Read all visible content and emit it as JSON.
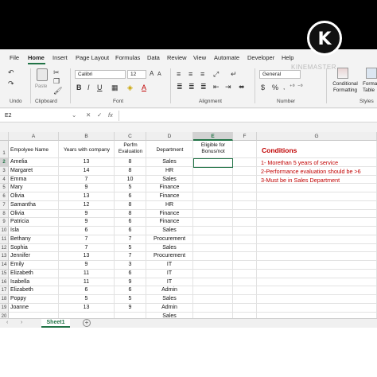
{
  "menu": {
    "file": "File",
    "home": "Home",
    "insert": "Insert",
    "page_layout": "Page Layout",
    "formulas": "Formulas",
    "data": "Data",
    "review": "Review",
    "view": "View",
    "automate": "Automate",
    "developer": "Developer",
    "help": "Help"
  },
  "ribbon": {
    "undo_label": "Undo",
    "clipboard_label": "Clipboard",
    "paste_label": "Paste",
    "font_name": "Calibri",
    "font_size": "12",
    "font_label": "Font",
    "alignment_label": "Alignment",
    "number_format": "General",
    "number_label": "Number",
    "conditional_formatting": "Conditional Formatting",
    "format_as_table": "Format as Table",
    "styles_label": "Styles",
    "currency_symbol": "$",
    "percent_symbol": "%"
  },
  "formula_bar": {
    "name_box": "E2",
    "fx": "fx",
    "value": ""
  },
  "watermark": "KINEMASTER",
  "logo_letter": "K",
  "columns": [
    "A",
    "B",
    "C",
    "D",
    "E",
    "F",
    "G"
  ],
  "headers": {
    "employee": "Empolyee Name",
    "years": "Years with company",
    "perfm": "Perfm Evaluation",
    "department": "Department",
    "eligible": "Eligible for Bonus/not"
  },
  "rows": [
    {
      "num": "1"
    },
    {
      "num": "2",
      "name": "Amelia",
      "years": "13",
      "perfm": "8",
      "dept": "Sales"
    },
    {
      "num": "3",
      "name": "Margaret",
      "years": "14",
      "perfm": "8",
      "dept": "HR"
    },
    {
      "num": "4",
      "name": "Emma",
      "years": "7",
      "perfm": "10",
      "dept": "Sales"
    },
    {
      "num": "5",
      "name": "Mary",
      "years": "9",
      "perfm": "5",
      "dept": "Finance"
    },
    {
      "num": "6",
      "name": "Olivia",
      "years": "13",
      "perfm": "6",
      "dept": "Finance"
    },
    {
      "num": "7",
      "name": "Samantha",
      "years": "12",
      "perfm": "8",
      "dept": "HR"
    },
    {
      "num": "8",
      "name": "Olivia",
      "years": "9",
      "perfm": "8",
      "dept": "Finance"
    },
    {
      "num": "9",
      "name": "Patricia",
      "years": "9",
      "perfm": "6",
      "dept": "Finance"
    },
    {
      "num": "10",
      "name": "Isla",
      "years": "6",
      "perfm": "6",
      "dept": "Sales"
    },
    {
      "num": "11",
      "name": "Bethany",
      "years": "7",
      "perfm": "7",
      "dept": "Procurement"
    },
    {
      "num": "12",
      "name": "Sophia",
      "years": "7",
      "perfm": "5",
      "dept": "Sales"
    },
    {
      "num": "13",
      "name": "Jennifer",
      "years": "13",
      "perfm": "7",
      "dept": "Procurement"
    },
    {
      "num": "14",
      "name": "Emily",
      "years": "9",
      "perfm": "3",
      "dept": "IT"
    },
    {
      "num": "15",
      "name": "Elizabeth",
      "years": "11",
      "perfm": "6",
      "dept": "IT"
    },
    {
      "num": "16",
      "name": "Isabella",
      "years": "11",
      "perfm": "9",
      "dept": "IT"
    },
    {
      "num": "17",
      "name": "Elizabeth",
      "years": "6",
      "perfm": "6",
      "dept": "Admin"
    },
    {
      "num": "18",
      "name": "Poppy",
      "years": "5",
      "perfm": "5",
      "dept": "Sales"
    },
    {
      "num": "19",
      "name": "Joanne",
      "years": "13",
      "perfm": "9",
      "dept": "Admin"
    },
    {
      "num": "20",
      "name": "",
      "years": "",
      "perfm": "",
      "dept": "Sales"
    }
  ],
  "conditions": {
    "title": "Conditions",
    "items": [
      "1- Morethan 5 years of service",
      "2-Performance evaluation should be >6",
      "3-Must be in Sales Department"
    ]
  },
  "sheet": {
    "name": "Sheet1",
    "add": "+"
  },
  "colors": {
    "excel_green": "#217346",
    "condition_red": "#c00000"
  }
}
